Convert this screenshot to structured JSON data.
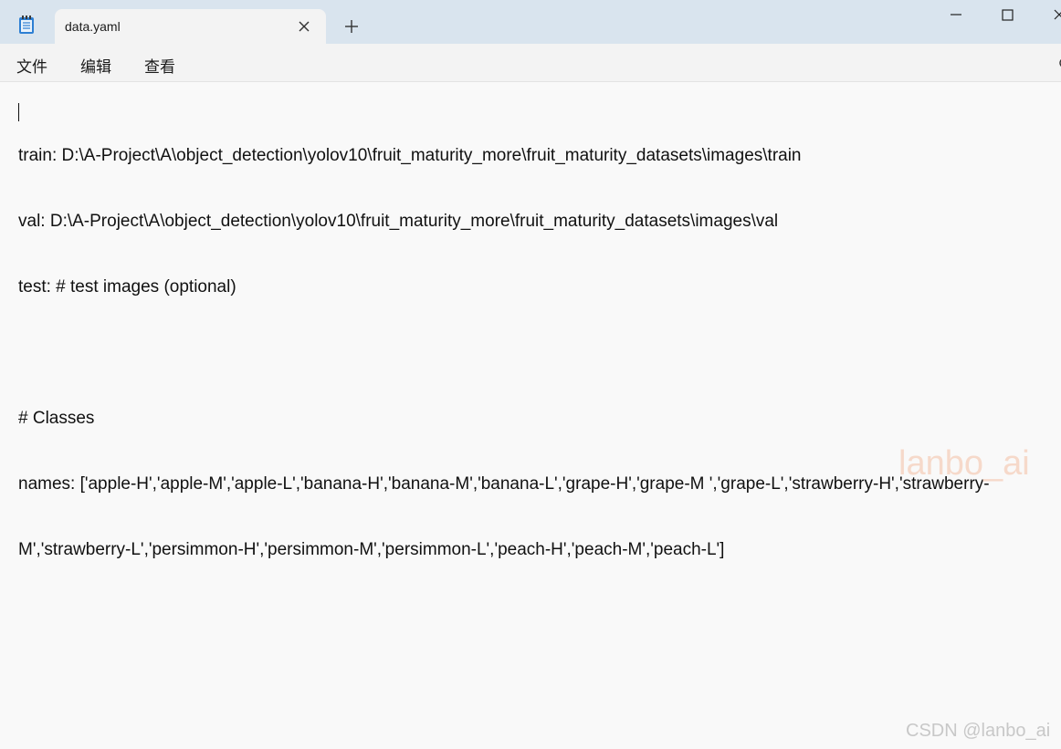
{
  "tab": {
    "title": "data.yaml"
  },
  "menu": {
    "file": "文件",
    "edit": "编辑",
    "view": "查看"
  },
  "editor": {
    "lines": [
      "train: D:\\A-Project\\A\\object_detection\\yolov10\\fruit_maturity_more\\fruit_maturity_datasets\\images\\train",
      "val: D:\\A-Project\\A\\object_detection\\yolov10\\fruit_maturity_more\\fruit_maturity_datasets\\images\\val",
      "test: # test images (optional)",
      "",
      "# Classes",
      "names: ['apple-H','apple-M','apple-L','banana-H','banana-M','banana-L','grape-H','grape-M ','grape-L','strawberry-H','strawberry-",
      "M','strawberry-L','persimmon-H','persimmon-M','persimmon-L','peach-H','peach-M','peach-L']"
    ]
  },
  "watermarks": {
    "center": "lanbo_ai",
    "bottom": "CSDN @lanbo_ai"
  },
  "icons": {
    "app": "notepad-icon",
    "close": "close-icon",
    "new_tab": "plus-icon",
    "minimize": "minimize-icon",
    "maximize": "maximize-icon",
    "window_close": "window-close-icon",
    "settings": "gear-icon"
  }
}
